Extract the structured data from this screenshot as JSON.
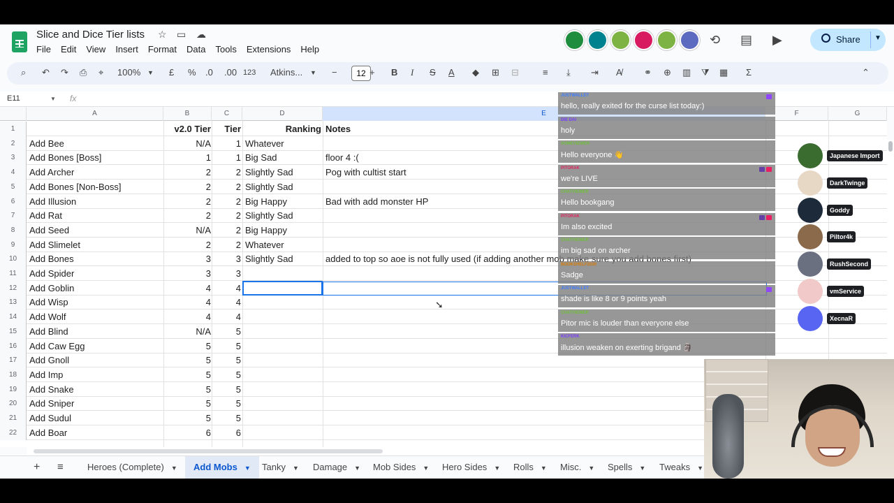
{
  "doc": {
    "title": "Slice and Dice Tier lists",
    "menu": [
      "File",
      "Edit",
      "View",
      "Insert",
      "Format",
      "Data",
      "Tools",
      "Extensions",
      "Help"
    ],
    "share_label": "Share"
  },
  "toolbar": {
    "zoom": "100%",
    "currency": "£",
    "percent": "%",
    "dec_dec": ".0",
    "dec_inc": ".00",
    "number_format": "123",
    "font": "Atkins...",
    "font_size": "12",
    "minus": "−",
    "plus": "+",
    "bold": "B",
    "italic": "I",
    "strike": "S",
    "text_color": "A"
  },
  "formula_bar": {
    "cell": "E11",
    "fx": "fx"
  },
  "columns": [
    "A",
    "B",
    "C",
    "D",
    "E",
    "F",
    "G"
  ],
  "headers": {
    "b": "v2.0 Tier",
    "c": "Tier",
    "d": "Ranking",
    "e": "Notes"
  },
  "rows": [
    {
      "n": "1",
      "a": "",
      "b": "",
      "c": "",
      "d": "",
      "e": ""
    },
    {
      "n": "2",
      "a": "Add Bee",
      "b": "N/A",
      "c": "1",
      "d": "Whatever",
      "e": ""
    },
    {
      "n": "3",
      "a": "Add Bones [Boss]",
      "b": "1",
      "c": "1",
      "d": "Big Sad",
      "e": "floor 4 :("
    },
    {
      "n": "4",
      "a": "Add Archer",
      "b": "2",
      "c": "2",
      "d": "Slightly Sad",
      "e": "Pog with cultist start"
    },
    {
      "n": "5",
      "a": "Add Bones [Non-Boss]",
      "b": "2",
      "c": "2",
      "d": "Slightly Sad",
      "e": ""
    },
    {
      "n": "6",
      "a": "Add Illusion",
      "b": "2",
      "c": "2",
      "d": "Big Happy",
      "e": "Bad with add monster HP"
    },
    {
      "n": "7",
      "a": "Add Rat",
      "b": "2",
      "c": "2",
      "d": "Slightly Sad",
      "e": ""
    },
    {
      "n": "8",
      "a": "Add Seed",
      "b": "N/A",
      "c": "2",
      "d": "Big Happy",
      "e": ""
    },
    {
      "n": "9",
      "a": "Add Slimelet",
      "b": "2",
      "c": "2",
      "d": "Whatever",
      "e": ""
    },
    {
      "n": "10",
      "a": "Add Bones",
      "b": "3",
      "c": "3",
      "d": "Slightly Sad",
      "e": "added to top so aoe is not fully used (if adding another mob make sure you add bones first)"
    },
    {
      "n": "11",
      "a": "Add Spider",
      "b": "3",
      "c": "3",
      "d": "",
      "e": ""
    },
    {
      "n": "12",
      "a": "Add Goblin",
      "b": "4",
      "c": "4",
      "d": "",
      "e": ""
    },
    {
      "n": "13",
      "a": "Add Wisp",
      "b": "4",
      "c": "4",
      "d": "",
      "e": ""
    },
    {
      "n": "14",
      "a": "Add Wolf",
      "b": "4",
      "c": "4",
      "d": "",
      "e": ""
    },
    {
      "n": "15",
      "a": "Add Blind",
      "b": "N/A",
      "c": "5",
      "d": "",
      "e": ""
    },
    {
      "n": "16",
      "a": "Add Caw Egg",
      "b": "5",
      "c": "5",
      "d": "",
      "e": ""
    },
    {
      "n": "17",
      "a": "Add Gnoll",
      "b": "5",
      "c": "5",
      "d": "",
      "e": ""
    },
    {
      "n": "18",
      "a": "Add Imp",
      "b": "5",
      "c": "5",
      "d": "",
      "e": ""
    },
    {
      "n": "19",
      "a": "Add Snake",
      "b": "5",
      "c": "5",
      "d": "",
      "e": ""
    },
    {
      "n": "20",
      "a": "Add Sniper",
      "b": "5",
      "c": "5",
      "d": "",
      "e": ""
    },
    {
      "n": "21",
      "a": "Add Sudul",
      "b": "5",
      "c": "5",
      "d": "",
      "e": ""
    },
    {
      "n": "22",
      "a": "Add Boar",
      "b": "6",
      "c": "6",
      "d": "",
      "e": ""
    }
  ],
  "sheet_tabs": [
    "Heroes (Complete)",
    "Add Mobs",
    "Tanky",
    "Damage",
    "Mob Sides",
    "Hero Sides",
    "Rolls",
    "Misc.",
    "Spells",
    "Tweaks"
  ],
  "active_tab": "Add Mobs",
  "chat": [
    {
      "user": "JUSTWALLET",
      "color": "#3d7dff",
      "text": "hello, really exited for the curse list today:)"
    },
    {
      "user": "DIE DAI",
      "color": "#7a3cff",
      "text": "holy"
    },
    {
      "user": "SOMEVIEWER",
      "color": "#6fbf3a",
      "text": "Hello everyone 👋"
    },
    {
      "user": "PITORAK",
      "color": "#e0245e",
      "text": "we're LIVE"
    },
    {
      "user": "CHATVIEWER",
      "color": "#6fbf3a",
      "text": "Hello bookgang"
    },
    {
      "user": "PITORAK",
      "color": "#e0245e",
      "text": "Im also excited"
    },
    {
      "user": "CHATVIEWER",
      "color": "#6fbf3a",
      "text": "im big sad on archer"
    },
    {
      "user": "BOOKSHELF2020",
      "color": "#d97a00",
      "text": "Sadge"
    },
    {
      "user": "JUSTWALLET",
      "color": "#3d7dff",
      "text": "shade is like 8 or 9 points yeah"
    },
    {
      "user": "CHATVIEWER",
      "color": "#6fbf3a",
      "text": "Pitor mic is louder than everyone else"
    },
    {
      "user": "KICFERK",
      "color": "#7a3cff",
      "text": "illusion weaken on exerting brigand 🗿"
    }
  ],
  "voice": [
    {
      "name": "Japanese Import",
      "color": "#3a6b2f"
    },
    {
      "name": "DarkTwinge",
      "color": "#e7d8c6"
    },
    {
      "name": "Goddy",
      "color": "#1d2a3a"
    },
    {
      "name": "Piltor4k",
      "color": "#8a6a4a"
    },
    {
      "name": "RushSecond",
      "color": "#6a7080"
    },
    {
      "name": "vmService",
      "color": "#f2c9c9"
    },
    {
      "name": "XecnaR",
      "color": "#5865f2"
    }
  ],
  "avatar_colors": [
    "#1e8e3e",
    "#00838f",
    "#7cb342",
    "#d81b60",
    "#7cb342",
    "#5c6bc0"
  ]
}
